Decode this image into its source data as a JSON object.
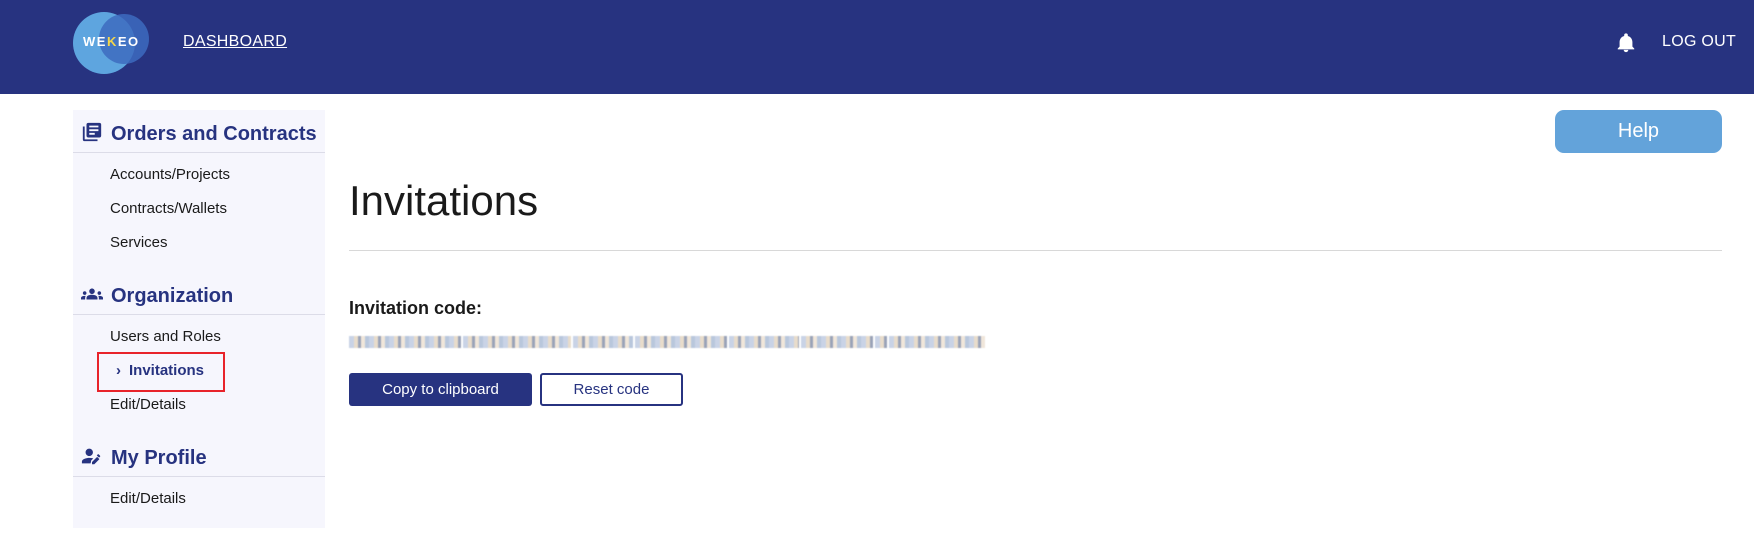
{
  "header": {
    "logo_text_pre": "WE",
    "logo_text_k": "K",
    "logo_text_post": "EO",
    "dashboard_label": "DASHBOARD",
    "logout_label": "LOG OUT",
    "bell_icon": "bell-icon"
  },
  "sidebar": {
    "sections": [
      {
        "title": "Orders and Contracts",
        "icon": "document-list-icon",
        "items": [
          "Accounts/Projects",
          "Contracts/Wallets",
          "Services"
        ]
      },
      {
        "title": "Organization",
        "icon": "group-icon",
        "items": [
          "Users and Roles",
          "Invitations",
          "Edit/Details"
        ]
      },
      {
        "title": "My Profile",
        "icon": "user-edit-icon",
        "items": [
          "Edit/Details"
        ]
      }
    ],
    "active_item": "Invitations"
  },
  "main": {
    "help_label": "Help",
    "title": "Invitations",
    "invitation_label": "Invitation code:",
    "copy_label": "Copy to clipboard",
    "reset_label": "Reset code"
  },
  "colors": {
    "header_bg": "#273380",
    "accent": "#273380",
    "help_bg": "#63a3da",
    "highlight": "#e8232a"
  }
}
